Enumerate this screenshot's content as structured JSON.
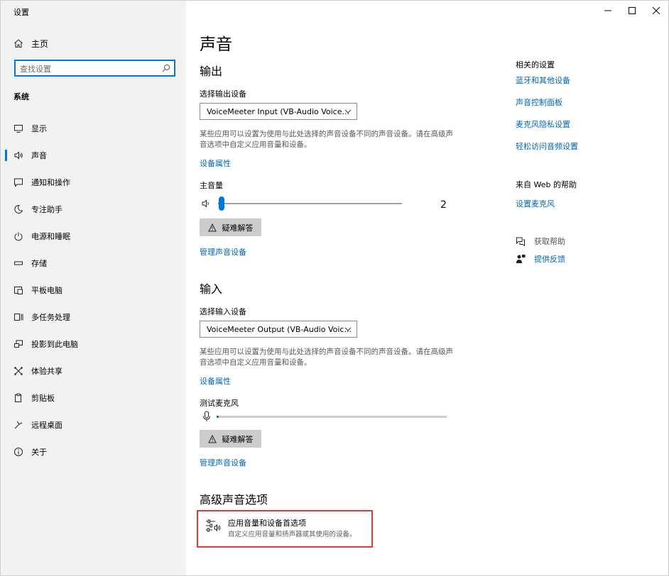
{
  "window": {
    "title": "设置"
  },
  "sidebar": {
    "home_label": "主页",
    "search_placeholder": "查找设置",
    "section_label": "系统",
    "items": [
      {
        "label": "显示",
        "icon": "monitor-icon"
      },
      {
        "label": "声音",
        "icon": "speaker-icon",
        "active": true
      },
      {
        "label": "通知和操作",
        "icon": "notification-icon"
      },
      {
        "label": "专注助手",
        "icon": "moon-icon"
      },
      {
        "label": "电源和睡眠",
        "icon": "power-icon"
      },
      {
        "label": "存储",
        "icon": "storage-icon"
      },
      {
        "label": "平板电脑",
        "icon": "tablet-icon"
      },
      {
        "label": "多任务处理",
        "icon": "multitask-icon"
      },
      {
        "label": "投影到此电脑",
        "icon": "projection-icon"
      },
      {
        "label": "体验共享",
        "icon": "share-icon"
      },
      {
        "label": "剪贴板",
        "icon": "clipboard-icon"
      },
      {
        "label": "远程桌面",
        "icon": "remote-desktop-icon"
      },
      {
        "label": "关于",
        "icon": "info-icon"
      }
    ]
  },
  "main": {
    "page_title": "声音",
    "output": {
      "heading": "输出",
      "select_label": "选择输出设备",
      "device": "VoiceMeeter Input (VB-Audio Voice...",
      "description": "某些应用可以设置为使用与此处选择的声音设备不同的声音设备。请在高级声音选项中自定义应用音量和设备。",
      "properties_link": "设备属性",
      "volume_label": "主音量",
      "volume_value": "2",
      "volume_level": 2,
      "troubleshoot_label": "疑难解答",
      "manage_link": "管理声音设备"
    },
    "input": {
      "heading": "输入",
      "select_label": "选择输入设备",
      "device": "VoiceMeeter Output (VB-Audio Voic...",
      "description": "某些应用可以设置为使用与此处选择的声音设备不同的声音设备。请在高级声音选项中自定义应用音量和设备。",
      "properties_link": "设备属性",
      "test_mic_label": "测试麦克风",
      "mic_level": 1,
      "troubleshoot_label": "疑难解答",
      "manage_link": "管理声音设备"
    },
    "advanced": {
      "heading": "高级声音选项",
      "item_title": "应用音量和设备首选项",
      "item_subtitle": "自定义应用音量和扬声器或其使用的设备。"
    }
  },
  "related": {
    "heading": "相关的设置",
    "links": [
      "蓝牙和其他设备",
      "声音控制面板",
      "麦克风隐私设置",
      "轻松访问音频设置"
    ],
    "web_help_heading": "来自 Web 的帮助",
    "web_help_link": "设置麦克风",
    "get_help": "获取帮助",
    "feedback": "提供反馈"
  },
  "colors": {
    "accent": "#0078d7",
    "link": "#0066b4",
    "highlight_border": "#e53935"
  }
}
